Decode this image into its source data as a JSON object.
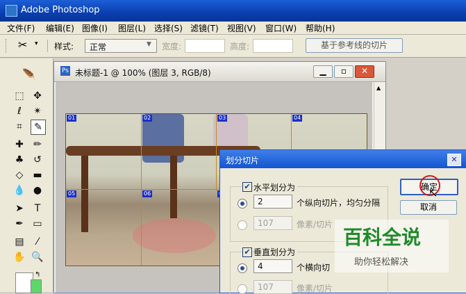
{
  "app": {
    "title": "Adobe Photoshop"
  },
  "menu": [
    "文件(F)",
    "编辑(E)",
    "图像(I)",
    "图层(L)",
    "选择(S)",
    "滤镜(T)",
    "视图(V)",
    "窗口(W)",
    "帮助(H)"
  ],
  "options": {
    "style_label": "样式:",
    "style_value": "正常",
    "width_label": "宽度:",
    "height_label": "高度:",
    "guide_slice_button": "基于参考线的切片"
  },
  "document": {
    "title": "未标题-1 @ 100% (图层 3, RGB/8)",
    "slice_tags": [
      "01",
      "02",
      "03",
      "04",
      "05",
      "06",
      "07"
    ]
  },
  "dialog": {
    "title": "划分切片",
    "horizontal": {
      "label": "水平划分为",
      "checked": true,
      "count": "2",
      "count_suffix": "个纵向切片，均匀分隔",
      "pixels": "107",
      "pixels_suffix": "像素/切片"
    },
    "vertical": {
      "label": "垂直划分为",
      "checked": true,
      "count": "4",
      "count_suffix": "个横向切",
      "pixels": "107",
      "pixels_suffix": "像素/切片"
    },
    "ok_button": "确定",
    "cancel_button": "取消"
  },
  "watermark": {
    "title": "百科全说",
    "subtitle": "助你轻松解决"
  },
  "colors": {
    "titlebar": "#0a3fb0",
    "slice_tag": "#1a2fc8",
    "slice_line": "#c08a25",
    "watermark": "#1f8a2a"
  }
}
